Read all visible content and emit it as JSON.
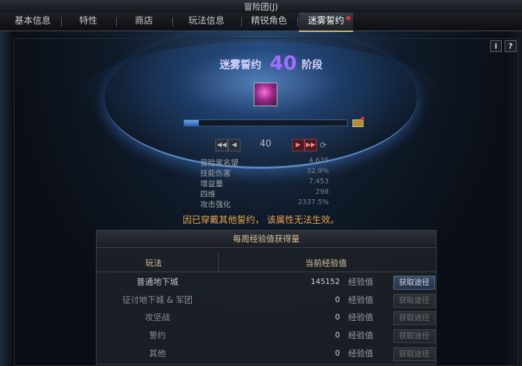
{
  "window": {
    "title": "冒险团(J)"
  },
  "tabs": [
    {
      "label": "基本信息"
    },
    {
      "label": "特性"
    },
    {
      "label": "商店"
    },
    {
      "label": "玩法信息"
    },
    {
      "label": "精锐角色"
    },
    {
      "label": "迷雾誓约"
    }
  ],
  "help": {
    "info": "i",
    "question": "?"
  },
  "oath": {
    "prefix": "迷雾誓约",
    "level": "40",
    "suffix": "阶段",
    "progress": 0.09
  },
  "pager": {
    "current": "40"
  },
  "stats": [
    {
      "name": "冒险家名望",
      "value": "4,635"
    },
    {
      "name": "技能伤害",
      "value": "32.9%"
    },
    {
      "name": "增益量",
      "value": "7,453"
    },
    {
      "name": "四维",
      "value": "298"
    },
    {
      "name": "攻击强化",
      "value": "2337.5%"
    }
  ],
  "warning": "因已穿戴其他誓约， 该属性无法生效。",
  "weekly": {
    "title": "每周经验值获得量",
    "col_mode": "玩法",
    "col_exp": "当前经验值",
    "rows": [
      {
        "name": "普通地下城",
        "value": "145152",
        "unit": "经验值",
        "button": "获取途径"
      },
      {
        "name": "征讨地下城 & 军团",
        "value": "0",
        "unit": "经验值",
        "button": "获取途径"
      },
      {
        "name": "攻坚战",
        "value": "0",
        "unit": "经验值",
        "button": "获取途径"
      },
      {
        "name": "誓约",
        "value": "0",
        "unit": "经验值",
        "button": "获取途径"
      },
      {
        "name": "其他",
        "value": "0",
        "unit": "经验值",
        "button": "获取途径"
      }
    ]
  }
}
